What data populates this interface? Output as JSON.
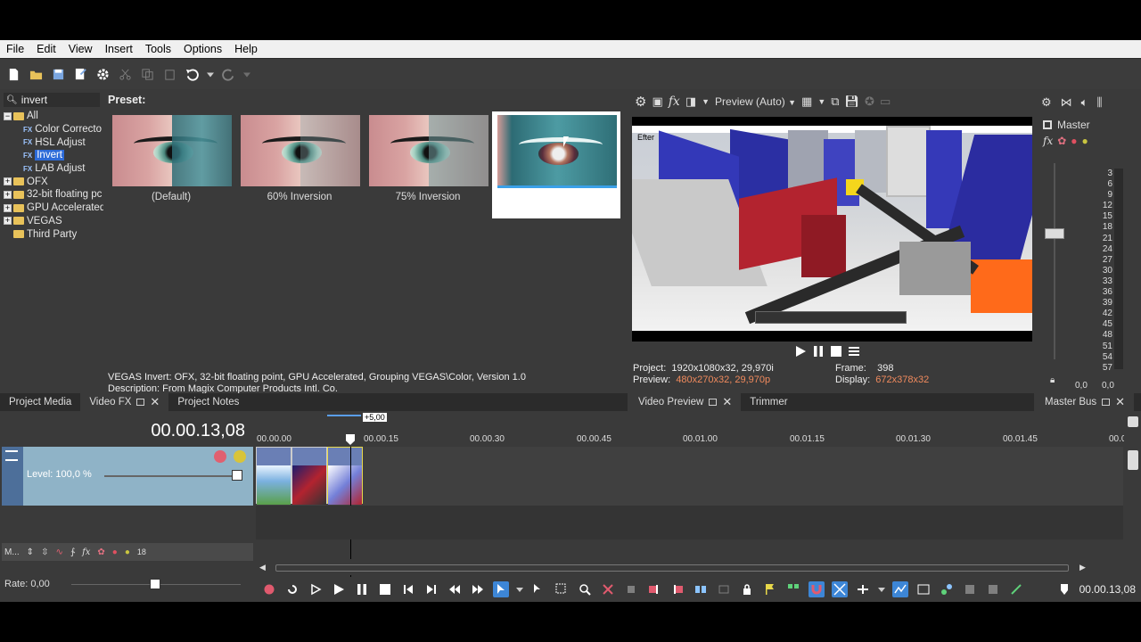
{
  "menu": [
    "File",
    "Edit",
    "View",
    "Insert",
    "Tools",
    "Options",
    "Help"
  ],
  "search": {
    "value": "invert"
  },
  "tree": {
    "all": "All",
    "children": [
      "Color Correcto",
      "HSL Adjust",
      "Invert",
      "LAB Adjust"
    ],
    "fx_tag": "FX",
    "groups": [
      "OFX",
      "32-bit floating pc",
      "GPU Accelerated",
      "VEGAS",
      "Third Party"
    ]
  },
  "presets": {
    "title": "Preset:",
    "items": [
      "(Default)",
      "60% Inversion",
      "75% Inversion",
      ""
    ]
  },
  "description": {
    "line1": "VEGAS Invert: OFX, 32-bit floating point, GPU Accelerated, Grouping VEGAS\\Color, Version 1.0",
    "line2": "Description: From Magix Computer Products Intl. Co."
  },
  "left_tabs": [
    "Project Media",
    "Video FX",
    "Project Notes"
  ],
  "preview": {
    "mode": "Preview (Auto)",
    "overlay_label": "Efter",
    "project_label": "Project:",
    "project_value": "1920x1080x32, 29,970i",
    "preview_label": "Preview:",
    "preview_value": "480x270x32, 29,970p",
    "frame_label": "Frame:",
    "frame_value": "398",
    "display_label": "Display:",
    "display_value": "672x378x32",
    "tabs": [
      "Video Preview",
      "Trimmer"
    ]
  },
  "master": {
    "label": "Master",
    "scale": [
      "3",
      "6",
      "9",
      "12",
      "15",
      "18",
      "21",
      "24",
      "27",
      "30",
      "33",
      "36",
      "39",
      "42",
      "45",
      "48",
      "51",
      "54",
      "57"
    ],
    "left_value": "0,0",
    "right_value": "0,0",
    "tab": "Master Bus"
  },
  "timeline": {
    "timecode": "00.00.13,08",
    "marker": "+5,00",
    "ticks": [
      "00.00.00",
      "00.00.15",
      "00.00.30",
      "00.00.45",
      "00.01.00",
      "00.01.15",
      "00.01.30",
      "00.01.45",
      "00.0"
    ],
    "level": "Level: 100,0 %",
    "audio_bus": "M...",
    "audio_num": "18",
    "rate": "Rate: 0,00",
    "end_timecode": "00.00.13,08"
  },
  "colors": {
    "accent": "#3d86d6",
    "track_header": "#8fb3c7",
    "clip_header": "#6a7fb5",
    "info_red": "#f08a5d"
  }
}
